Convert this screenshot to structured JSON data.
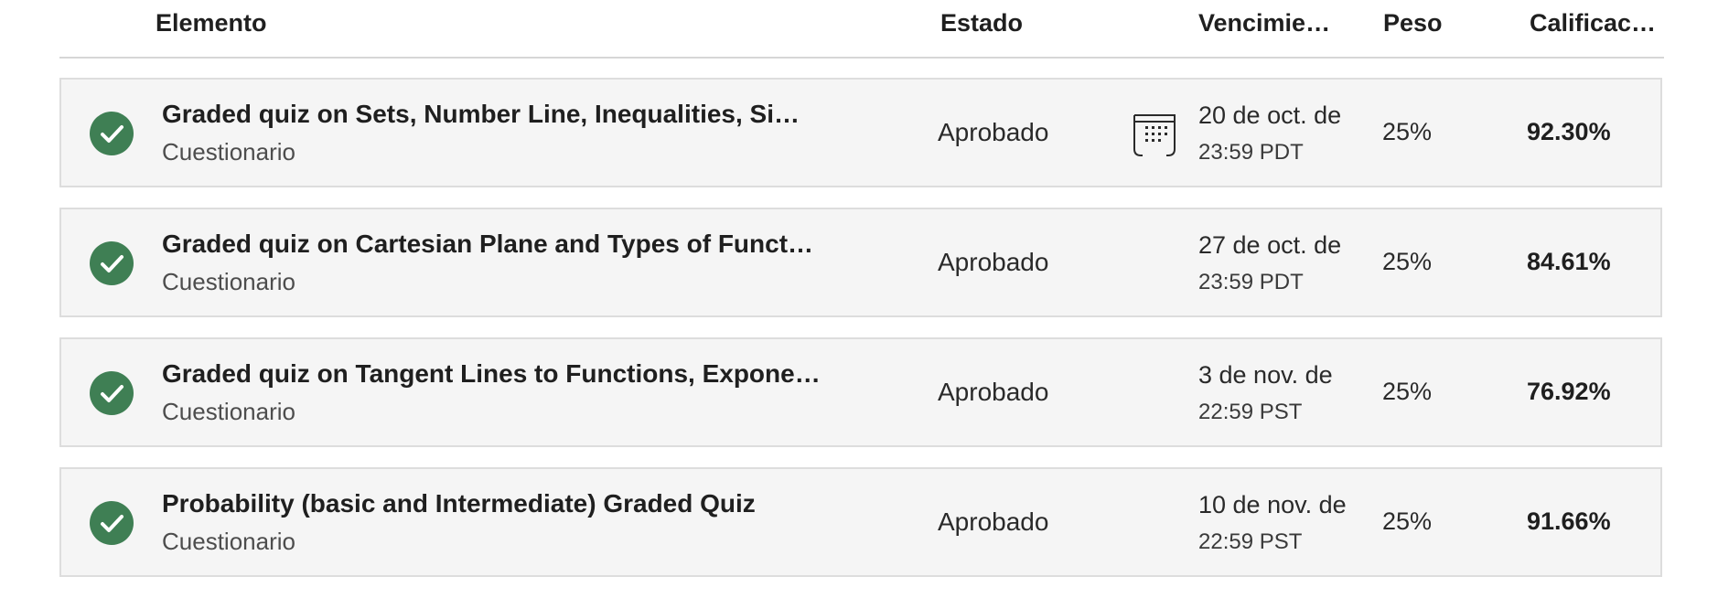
{
  "table": {
    "headers": {
      "element": "Elemento",
      "status": "Estado",
      "due": "Vencimie…",
      "weight": "Peso",
      "grade": "Calificac…"
    },
    "rows": [
      {
        "title": "Graded quiz on Sets, Number Line, Inequalities, Si…",
        "type": "Cuestionario",
        "status": "Aprobado",
        "due_date": "20 de oct. de",
        "due_time": "23:59 PDT",
        "weight": "25%",
        "grade": "92.30%",
        "status_icon": "check-circle-icon",
        "calendar_icon": "calendar-icon"
      },
      {
        "title": "Graded quiz on Cartesian Plane and Types of Funct…",
        "type": "Cuestionario",
        "status": "Aprobado",
        "due_date": "27 de oct. de",
        "due_time": "23:59 PDT",
        "weight": "25%",
        "grade": "84.61%",
        "status_icon": "check-circle-icon"
      },
      {
        "title": "Graded quiz on Tangent Lines to Functions, Expone…",
        "type": "Cuestionario",
        "status": "Aprobado",
        "due_date": "3 de nov. de",
        "due_time": "22:59 PST",
        "weight": "25%",
        "grade": "76.92%",
        "status_icon": "check-circle-icon"
      },
      {
        "title": "Probability (basic and Intermediate) Graded Quiz",
        "type": "Cuestionario",
        "status": "Aprobado",
        "due_date": "10 de nov. de",
        "due_time": "22:59 PST",
        "weight": "25%",
        "grade": "91.66%",
        "status_icon": "check-circle-icon"
      }
    ]
  },
  "colors": {
    "check_green": "#3f7f54",
    "row_background": "#f5f5f5",
    "row_border": "#dddddd"
  }
}
